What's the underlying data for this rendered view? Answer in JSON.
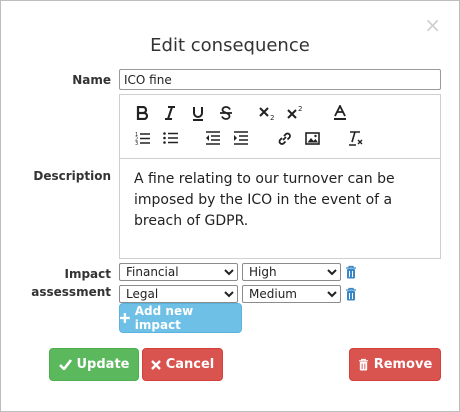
{
  "dialog": {
    "title": "Edit consequence",
    "close_icon": "×"
  },
  "form": {
    "name_label": "Name",
    "name_value": "ICO fine",
    "description_label": "Description",
    "description_text": "A fine relating to our turnover can be imposed by the ICO in the event of a breach of GDPR.",
    "impact_label": "Impact assessment"
  },
  "toolbar": {
    "icons": [
      "bold-icon",
      "italic-icon",
      "underline-icon",
      "strikethrough-icon",
      "subscript-icon",
      "superscript-icon",
      "font-color-icon",
      "ordered-list-icon",
      "bullet-list-icon",
      "outdent-icon",
      "indent-icon",
      "link-icon",
      "image-icon",
      "clear-format-icon"
    ]
  },
  "impacts": [
    {
      "type": "Financial",
      "level": "High"
    },
    {
      "type": "Legal",
      "level": "Medium"
    }
  ],
  "buttons": {
    "add_impact": "Add new impact",
    "update": "Update",
    "cancel": "Cancel",
    "remove": "Remove"
  },
  "colors": {
    "update": "#5cb85c",
    "cancel": "#d9534f",
    "remove": "#d9534f",
    "add": "#6ec0e6",
    "trash": "#3a87c8"
  }
}
